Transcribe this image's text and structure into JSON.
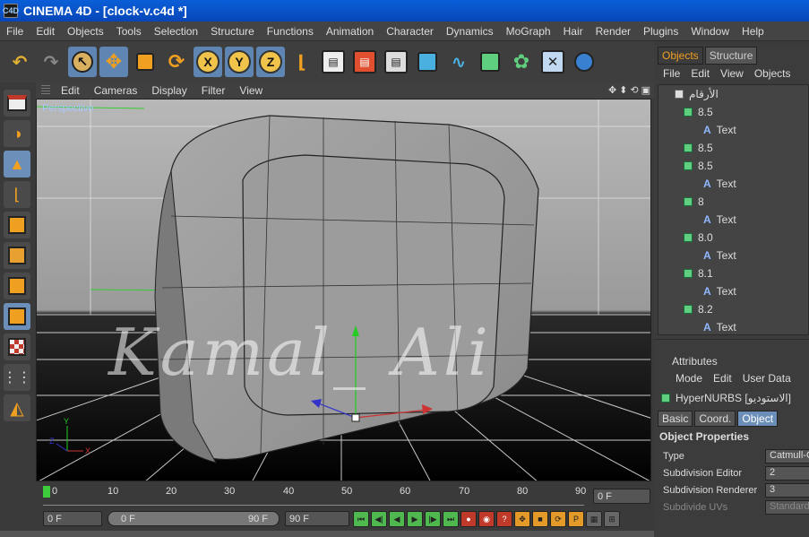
{
  "window": {
    "title": "CINEMA 4D - [clock-v.c4d *]"
  },
  "menu": [
    "File",
    "Edit",
    "Objects",
    "Tools",
    "Selection",
    "Structure",
    "Functions",
    "Animation",
    "Character",
    "Dynamics",
    "MoGraph",
    "Hair",
    "Render",
    "Plugins",
    "Window",
    "Help"
  ],
  "toolbar": {
    "axis_x": "X",
    "axis_y": "Y",
    "axis_z": "Z"
  },
  "viewport": {
    "menu": [
      "Edit",
      "Cameras",
      "Display",
      "Filter",
      "View"
    ],
    "camera_label": "Perspective",
    "watermark": "Kamal_ Ali"
  },
  "timeline": {
    "ticks": [
      "0",
      "10",
      "20",
      "30",
      "40",
      "50",
      "60",
      "70",
      "80",
      "90"
    ],
    "current_frame": "0 F",
    "start_field": "0 F",
    "range_start": "0 F",
    "range_end": "90 F",
    "end_field": "90 F"
  },
  "objects_panel": {
    "tabs": [
      "Objects",
      "Structure"
    ],
    "menu": [
      "File",
      "Edit",
      "View",
      "Objects"
    ],
    "root": "الأرقام",
    "items": [
      {
        "kind": "null",
        "label": "8.5"
      },
      {
        "kind": "text",
        "label": "Text"
      },
      {
        "kind": "null",
        "label": "8.5"
      },
      {
        "kind": "null",
        "label": "8.5"
      },
      {
        "kind": "text",
        "label": "Text"
      },
      {
        "kind": "null",
        "label": "8"
      },
      {
        "kind": "text",
        "label": "Text"
      },
      {
        "kind": "null",
        "label": "8.0"
      },
      {
        "kind": "text",
        "label": "Text"
      },
      {
        "kind": "null",
        "label": "8.1"
      },
      {
        "kind": "text",
        "label": "Text"
      },
      {
        "kind": "null",
        "label": "8.2"
      },
      {
        "kind": "text",
        "label": "Text"
      }
    ]
  },
  "attributes": {
    "header": "Attributes",
    "menu": [
      "Mode",
      "Edit",
      "User Data"
    ],
    "object_name": "HyperNURBS [الاستوديو]",
    "tabs": [
      "Basic",
      "Coord.",
      "Object"
    ],
    "section": "Object Properties",
    "props": [
      {
        "label": "Type",
        "value": "Catmull-C"
      },
      {
        "label": "Subdivision Editor",
        "value": "2"
      },
      {
        "label": "Subdivision Renderer",
        "value": "3"
      },
      {
        "label": "Subdivide UVs",
        "value": "Standard"
      }
    ]
  },
  "colors": {
    "accent": "#f0a020",
    "selection": "#6b8fb8",
    "title": "#0a5fd8",
    "object_icon": "#5fcf7f"
  }
}
